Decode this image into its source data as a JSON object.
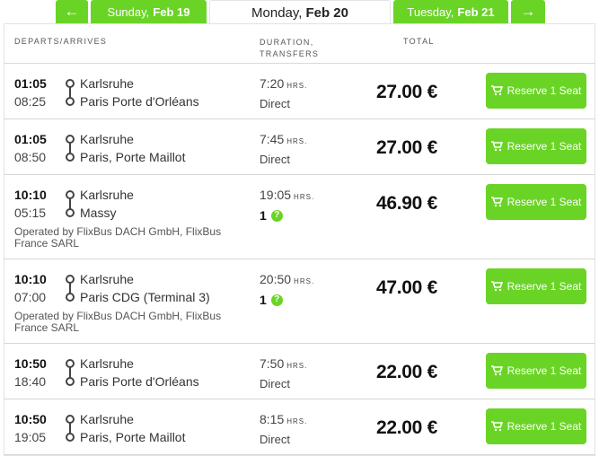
{
  "tabs": {
    "prev_arrow": "←",
    "prev_day": "Sunday,",
    "prev_date": "Feb 19",
    "current_day": "Monday,",
    "current_date": "Feb 20",
    "next_day": "Tuesday,",
    "next_date": "Feb 21",
    "next_arrow": "→"
  },
  "header": {
    "departs_arrives": "DEPARTS/ARRIVES",
    "duration_line1": "DURATION,",
    "duration_line2": "TRANSFERS",
    "total": "TOTAL"
  },
  "trips": [
    {
      "dep_time": "01:05",
      "arr_time": "08:25",
      "from": "Karlsruhe",
      "to": "Paris Porte d'Orléans",
      "duration": "7:20",
      "hrs": "HRS.",
      "direct": "Direct",
      "transfers": "",
      "operator": "",
      "price": "27.00 €",
      "reserve": "Reserve 1 Seat"
    },
    {
      "dep_time": "01:05",
      "arr_time": "08:50",
      "from": "Karlsruhe",
      "to": "Paris, Porte Maillot",
      "duration": "7:45",
      "hrs": "HRS.",
      "direct": "Direct",
      "transfers": "",
      "operator": "",
      "price": "27.00 €",
      "reserve": "Reserve 1 Seat"
    },
    {
      "dep_time": "10:10",
      "arr_time": "05:15",
      "from": "Karlsruhe",
      "to": "Massy",
      "duration": "19:05",
      "hrs": "HRS.",
      "direct": "",
      "transfers": "1",
      "operator": "Operated by FlixBus DACH GmbH, FlixBus France SARL",
      "price": "46.90 €",
      "reserve": "Reserve 1 Seat"
    },
    {
      "dep_time": "10:10",
      "arr_time": "07:00",
      "from": "Karlsruhe",
      "to": "Paris CDG (Terminal 3)",
      "duration": "20:50",
      "hrs": "HRS.",
      "direct": "",
      "transfers": "1",
      "operator": "Operated by FlixBus DACH GmbH, FlixBus France SARL",
      "price": "47.00 €",
      "reserve": "Reserve 1 Seat"
    },
    {
      "dep_time": "10:50",
      "arr_time": "18:40",
      "from": "Karlsruhe",
      "to": "Paris Porte d'Orléans",
      "duration": "7:50",
      "hrs": "HRS.",
      "direct": "Direct",
      "transfers": "",
      "operator": "",
      "price": "22.00 €",
      "reserve": "Reserve 1 Seat"
    },
    {
      "dep_time": "10:50",
      "arr_time": "19:05",
      "from": "Karlsruhe",
      "to": "Paris, Porte Maillot",
      "duration": "8:15",
      "hrs": "HRS.",
      "direct": "Direct",
      "transfers": "",
      "operator": "",
      "price": "22.00 €",
      "reserve": "Reserve 1 Seat"
    }
  ],
  "icons": {
    "cart": "cart-icon",
    "question": "question-icon",
    "question_glyph": "?"
  },
  "colors": {
    "accent": "#6ad426"
  }
}
